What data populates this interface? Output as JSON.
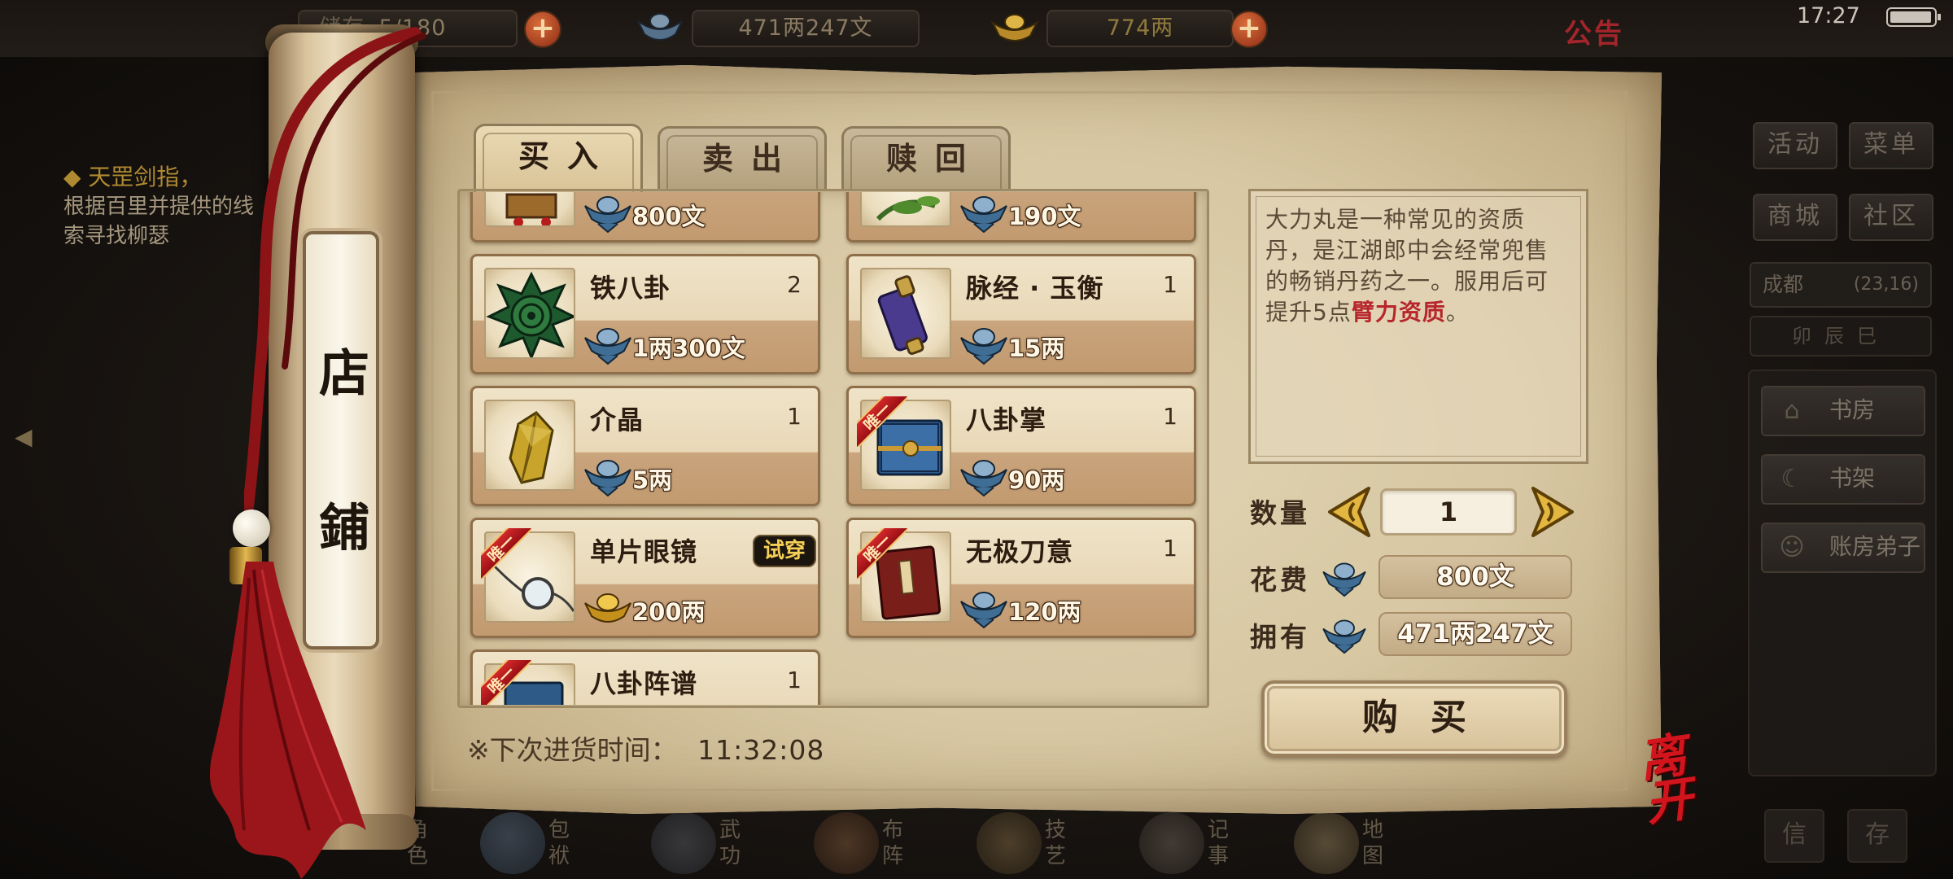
{
  "status_bar": {
    "bag_label": "储存",
    "bag_count": "5/180",
    "silver": "471两247文",
    "gold": "774两",
    "notice": "公告",
    "time": "17:27"
  },
  "background": {
    "quest_title": "◆ 天罡剑指，",
    "quest_lines": [
      "根据百里并提供的线",
      "索寻找柳瑟"
    ],
    "menu": {
      "activity": "活动",
      "menu": "菜单",
      "mall": "商城",
      "community": "社区"
    },
    "location": {
      "city": "成都",
      "coords": "(23,16)"
    },
    "time_period": "卯辰巳",
    "side_items": [
      "书房",
      "书架",
      "账房弟子"
    ],
    "corner_buttons": [
      "信",
      "存"
    ],
    "bottom_nav": [
      "角色",
      "包袱",
      "武功",
      "布阵",
      "技艺",
      "记事",
      "地图"
    ]
  },
  "shop": {
    "sign": [
      "店",
      "鋪"
    ],
    "tabs": [
      {
        "label": "买入",
        "active": true
      },
      {
        "label": "卖出",
        "active": false
      },
      {
        "label": "赎回",
        "active": false
      }
    ],
    "items": [
      {
        "name": "",
        "qty": "",
        "price": "800文",
        "currency": "silver",
        "selected": true,
        "unique": false,
        "icon": "gold-box-icon"
      },
      {
        "name": "",
        "qty": "",
        "price": "190文",
        "currency": "silver",
        "selected": false,
        "unique": false,
        "icon": "herb-icon"
      },
      {
        "name": "铁八卦",
        "qty": "2",
        "price": "1两300文",
        "currency": "silver",
        "selected": false,
        "unique": false,
        "icon": "iron-bagua-icon"
      },
      {
        "name": "脉经 · 玉衡",
        "qty": "1",
        "price": "15两",
        "currency": "silver",
        "selected": false,
        "unique": false,
        "icon": "scroll-icon"
      },
      {
        "name": "介晶",
        "qty": "1",
        "price": "5两",
        "currency": "silver",
        "selected": false,
        "unique": false,
        "icon": "crystal-icon"
      },
      {
        "name": "八卦掌",
        "qty": "1",
        "price": "90两",
        "currency": "silver",
        "selected": false,
        "unique": true,
        "icon": "book-icon"
      },
      {
        "name": "单片眼镜",
        "qty": "",
        "badge": "试穿",
        "price": "200两",
        "currency": "gold",
        "selected": false,
        "unique": true,
        "icon": "monocle-icon"
      },
      {
        "name": "无极刀意",
        "qty": "1",
        "price": "120两",
        "currency": "silver",
        "selected": false,
        "unique": true,
        "icon": "red-book-icon"
      },
      {
        "name": "八卦阵谱",
        "qty": "1",
        "price": "",
        "currency": "silver",
        "selected": false,
        "unique": true,
        "icon": "blue-book-icon"
      }
    ],
    "unique_label": "唯一",
    "restock_label": "※下次进货时间：",
    "restock_time": "11:32:08",
    "description": {
      "text": "大力丸是一种常见的资质丹，是江湖郎中会经常兜售的畅销丹药之一。服用后可提升5点",
      "highlight": "臂力资质",
      "end": "。"
    },
    "quantity_label": "数量",
    "quantity": "1",
    "cost_label": "花费",
    "cost": "800文",
    "owned_label": "拥有",
    "owned": "471两247文",
    "buy_label": "购买",
    "leave_label": "离开"
  },
  "colors": {
    "accent_red": "#b7262b",
    "gold_text": "#f6d056",
    "parchment": "#dccba6"
  }
}
